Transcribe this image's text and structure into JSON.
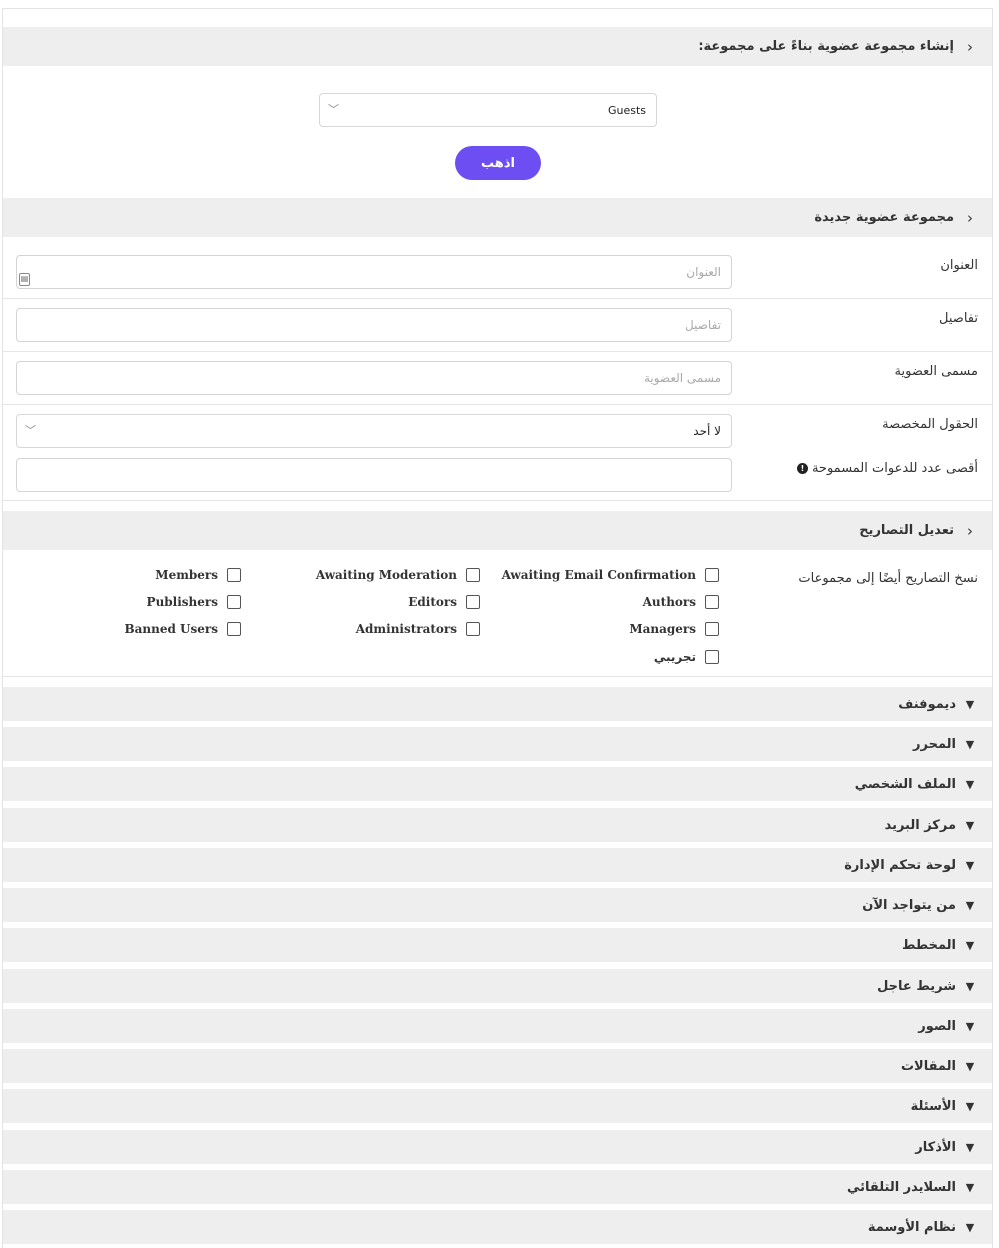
{
  "create_from_group": {
    "header": "إنشاء مجموعة عضوية بناءً على مجموعة:",
    "selected_group": "Guests",
    "go_button": "اذهب"
  },
  "new_group": {
    "header": "مجموعة عضوية جديدة",
    "fields": {
      "title": {
        "label": "العنوان",
        "placeholder": "العنوان"
      },
      "details": {
        "label": "تفاصيل",
        "placeholder": "تفاصيل"
      },
      "membership_name": {
        "label": "مسمى العضوية",
        "placeholder": "مسمى العضوية"
      },
      "custom_fields": {
        "label": "الحقول المخصصة",
        "value": "لا أحد"
      },
      "max_invites": {
        "label": "أقصى عدد للدعوات المسموحة"
      }
    }
  },
  "permissions": {
    "header": "تعديل التصاريح",
    "copy_label": "نسخ التصاريح أيضًا إلى مجموعات",
    "groups": [
      "Awaiting Email Confirmation",
      "Awaiting Moderation",
      "Members",
      "Authors",
      "Editors",
      "Publishers",
      "Managers",
      "Administrators",
      "Banned Users",
      "تجريبي"
    ]
  },
  "modules": [
    "ديموفنف",
    "المحرر",
    "الملف الشخصي",
    "مركز البريد",
    "لوحة تحكم الإدارة",
    "من يتواجد الآن",
    "المخطط",
    "شريط عاجل",
    "الصور",
    "المقالات",
    "الأسئلة",
    "الأذكار",
    "السلايدر التلقائي",
    "نظام الأوسمة"
  ],
  "icons": {
    "section_chevron": "chevron-left-icon",
    "module_chevron": "chevron-down-icon",
    "info": "exclamation-circle-icon",
    "id_card": "id-card-icon"
  },
  "colors": {
    "accent": "#6c4ef2",
    "header_bg": "#eeeeee"
  }
}
